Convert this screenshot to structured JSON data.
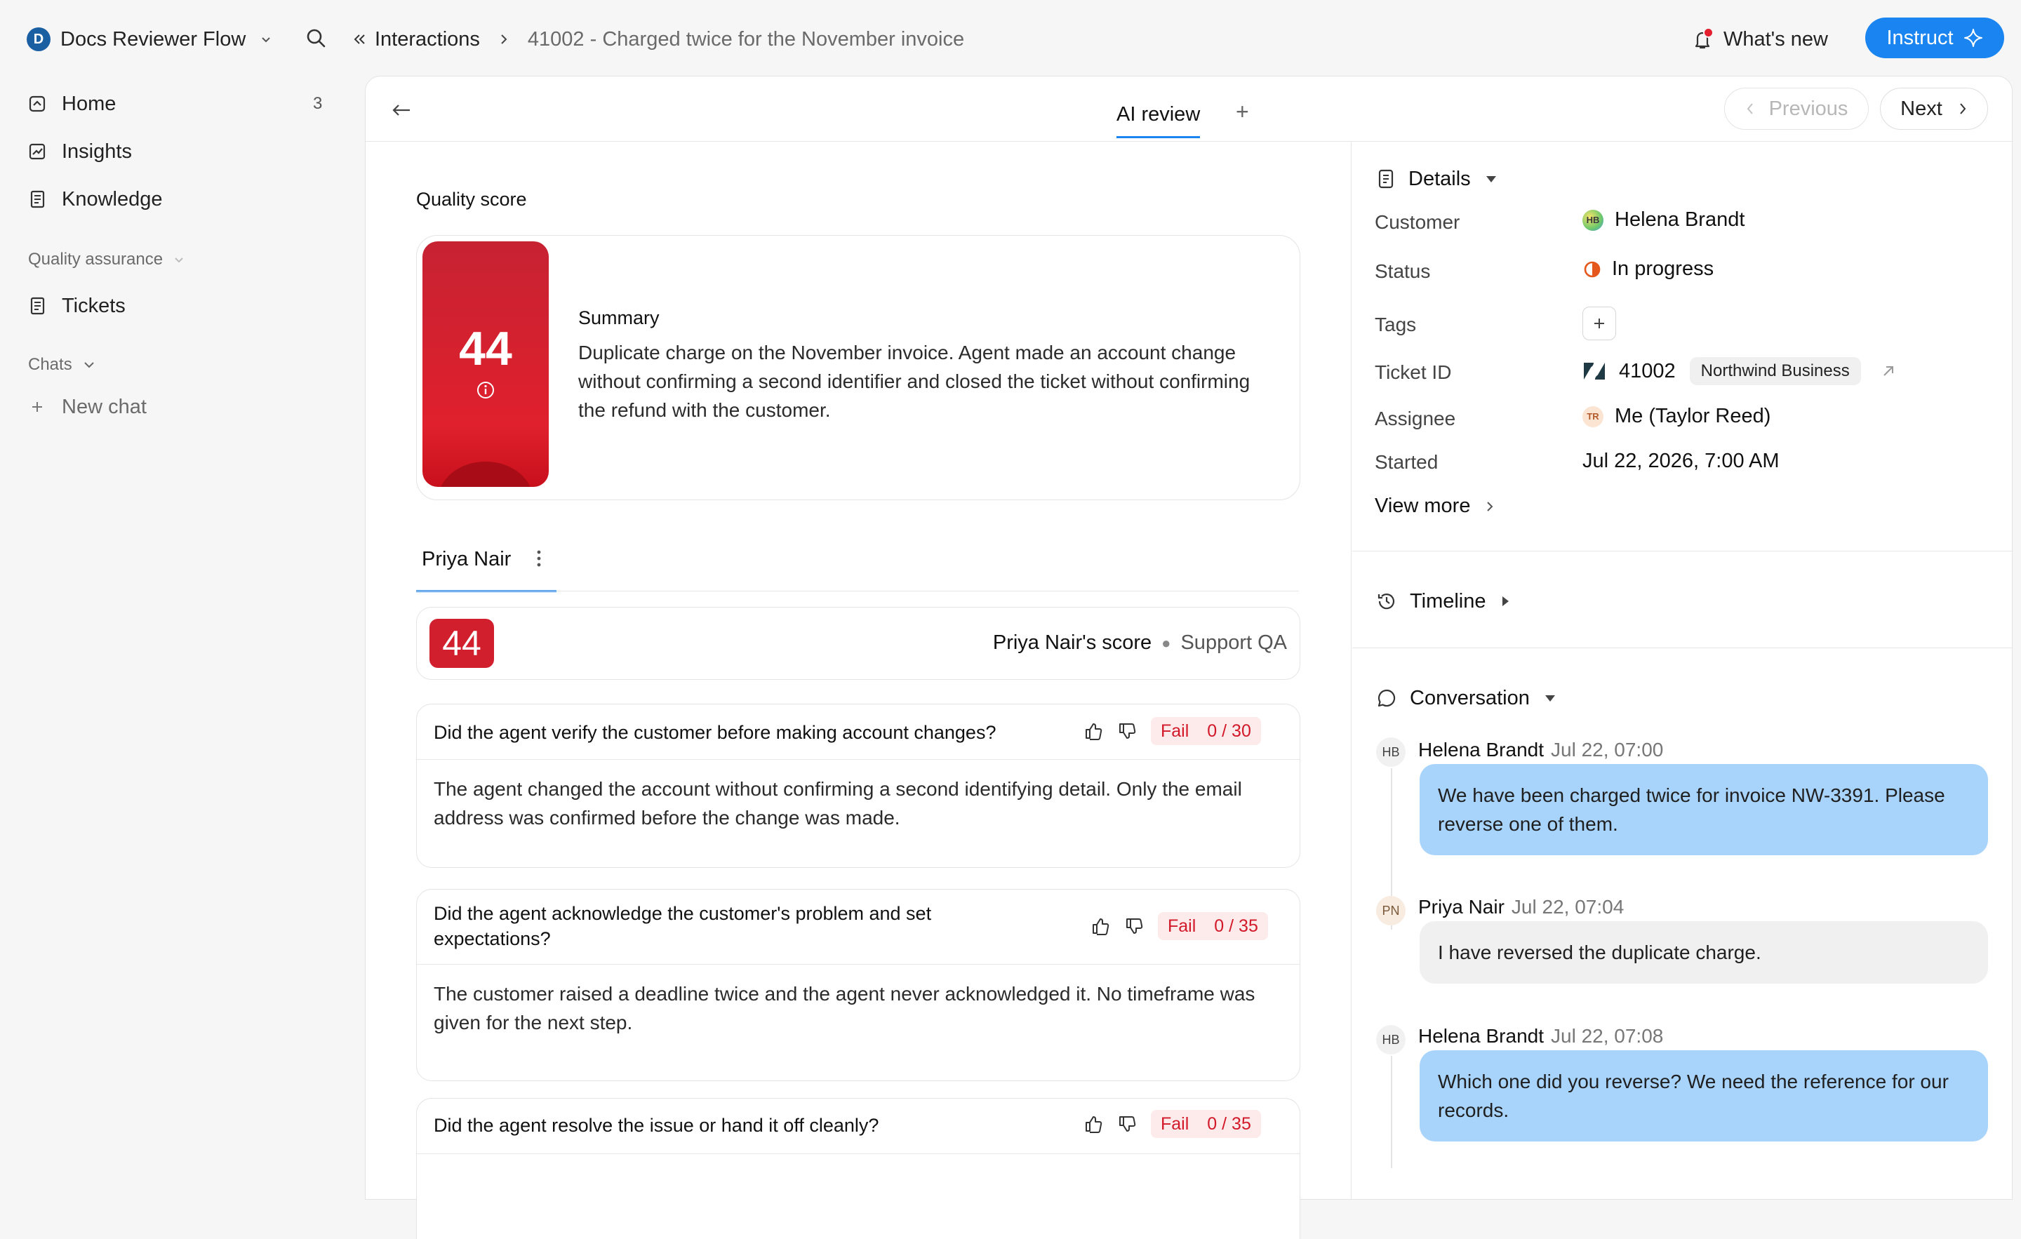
{
  "workspace": {
    "initial": "D",
    "name": "Docs Reviewer Flow"
  },
  "breadcrumb": {
    "parent": "Interactions",
    "current": "41002 - Charged twice for the November invoice"
  },
  "topbar": {
    "whats_new": "What's new",
    "instruct": "Instruct"
  },
  "sidebar": {
    "home": "Home",
    "home_count": "3",
    "insights": "Insights",
    "knowledge": "Knowledge",
    "qa_section": "Quality assurance",
    "tickets": "Tickets",
    "chats_section": "Chats",
    "new_chat": "New chat"
  },
  "panel": {
    "tab_ai_review": "AI review",
    "tab_add": "+",
    "previous": "Previous",
    "next": "Next"
  },
  "quality": {
    "title": "Quality score",
    "score": "44",
    "summary_title": "Summary",
    "summary_text": "Duplicate charge on the November invoice. Agent made an account change without confirming a second identifier and closed the ticket without confirming the refund with the customer."
  },
  "agent": {
    "tab_name": "Priya Nair",
    "score": "44",
    "score_label": "Priya Nair's score",
    "scorecard": "Support QA"
  },
  "questions": [
    {
      "question": "Did the agent verify the customer before making account changes?",
      "result": "Fail",
      "points": "0 / 30",
      "answer": "The agent changed the account without confirming a second identifying detail. Only the email address was confirmed before the change was made."
    },
    {
      "question": "Did the agent acknowledge the customer's problem and set expectations?",
      "result": "Fail",
      "points": "0 / 35",
      "answer": "The customer raised a deadline twice and the agent never acknowledged it. No timeframe was given for the next step."
    },
    {
      "question": "Did the agent resolve the issue or hand it off cleanly?",
      "result": "Fail",
      "points": "0 / 35"
    }
  ],
  "details": {
    "title": "Details",
    "customer_label": "Customer",
    "customer_initials": "HB",
    "customer_name": "Helena Brandt",
    "status_label": "Status",
    "status_value": "In progress",
    "tags_label": "Tags",
    "ticket_label": "Ticket ID",
    "ticket_id": "41002",
    "ticket_brand": "Northwind Business",
    "assignee_label": "Assignee",
    "assignee_initials": "TR",
    "assignee_name": "Me (Taylor Reed)",
    "started_label": "Started",
    "started_value": "Jul 22, 2026, 7:00 AM",
    "view_more": "View more"
  },
  "timeline": {
    "title": "Timeline"
  },
  "conversation": {
    "title": "Conversation",
    "messages": [
      {
        "initials": "HB",
        "author": "Helena Brandt",
        "time": "Jul 22, 07:00",
        "text": "We have been charged twice for invoice NW-3391. Please reverse one of them."
      },
      {
        "initials": "PN",
        "author": "Priya Nair",
        "time": "Jul 22, 07:04",
        "text": "I have reversed the duplicate charge."
      },
      {
        "initials": "HB",
        "author": "Helena Brandt",
        "time": "Jul 22, 07:08",
        "text": "Which one did you reverse? We need the reference for our records."
      }
    ]
  },
  "colors": {
    "accent": "#1a84f0",
    "score_red": "#d11f2e",
    "fail_text": "#d2192a",
    "customer_bubble": "#a8d3fb",
    "agent_bubble": "#f0f0f0"
  }
}
